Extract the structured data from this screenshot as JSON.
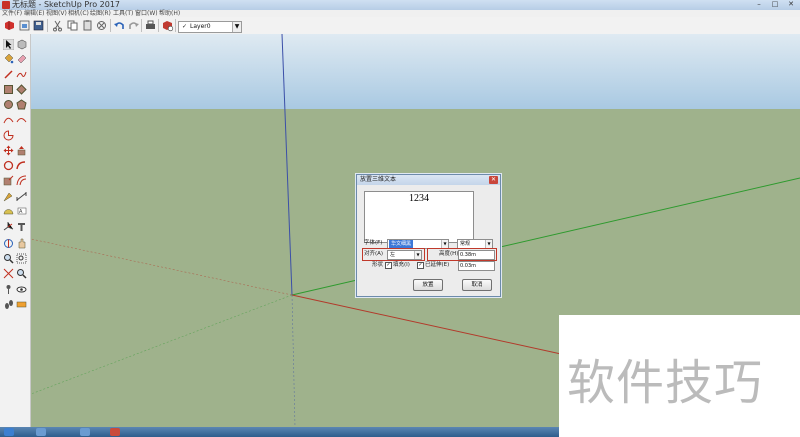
{
  "window": {
    "title": "无标题 - SketchUp Pro 2017",
    "buttons": {
      "minimize": "–",
      "maximize": "□",
      "close": "✕"
    }
  },
  "menubar": {
    "items": [
      "文件(F)",
      "编辑(E)",
      "视图(V)",
      "相机(C)",
      "绘图(R)",
      "工具(T)",
      "窗口(W)",
      "帮助(H)"
    ]
  },
  "toolbar": {
    "icons": [
      "sketchup-logo",
      "new-file",
      "open-file",
      "save-file",
      "cut",
      "copy",
      "paste",
      "erase",
      "undo",
      "redo",
      "print",
      "model-info"
    ],
    "layer": {
      "check": "✓",
      "value": "Layer0"
    }
  },
  "left_toolbar": {
    "icons": [
      "select",
      "make-component",
      "paint-bucket",
      "eraser",
      "line",
      "freehand",
      "rectangle",
      "rotated-rectangle",
      "circle",
      "polygon",
      "arc",
      "two-point-arc",
      "move",
      "push-pull",
      "rotate",
      "follow-me",
      "scale",
      "offset",
      "tape-measure",
      "dimension",
      "protractor",
      "text",
      "axes",
      "3d-text",
      "orbit",
      "pan",
      "zoom",
      "zoom-window",
      "zoom-extents",
      "previous",
      "position-camera",
      "look-around",
      "walk",
      "section-plane"
    ]
  },
  "dialog": {
    "title": "放置三维文本",
    "close": "✕",
    "text_value": "1234",
    "font_label": "字体(F)",
    "font_value": "华文细黑",
    "style_value": "常规",
    "align_label": "对齐(A)",
    "align_value": "左",
    "height_label": "高度(H)",
    "height_value": "0.38m",
    "form_label": "形状",
    "fill_checked": "✓",
    "fill_label": "填充(I)",
    "extruded_checked": "✓",
    "extruded_label": "已延伸(E)",
    "extrude_value": "0.03m",
    "place_button": "放置",
    "cancel_button": "取消"
  },
  "watermark": {
    "text": "软件技巧"
  },
  "colors": {
    "sky_top": "#dfeaf2",
    "sky_bottom": "#a9c9e2",
    "ground": "#9fb28c",
    "axis_blue": "#3b4fa8",
    "axis_green": "#2e9a2e",
    "axis_red": "#b23a2b",
    "highlight_box": "#c0392b"
  }
}
